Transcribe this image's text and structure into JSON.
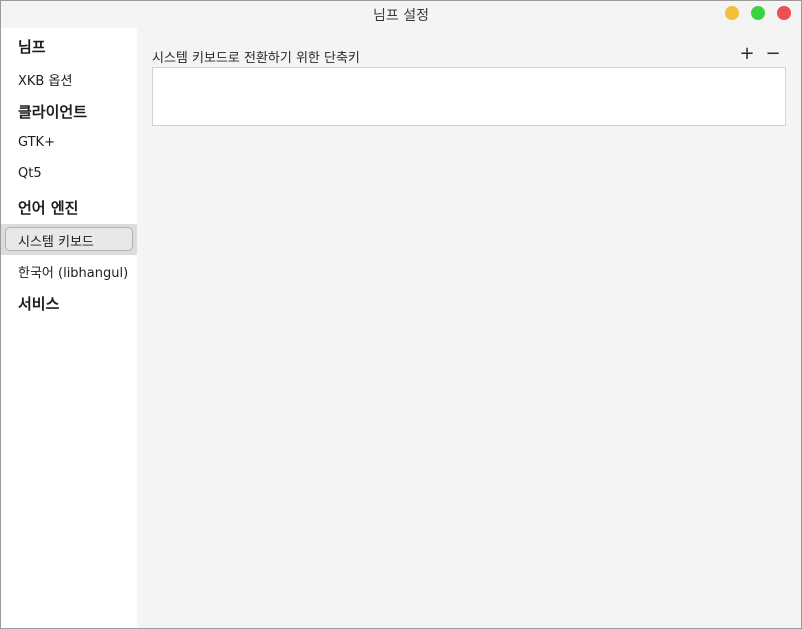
{
  "window": {
    "title": "님프 설정",
    "buttons": {
      "minimize_color": "#f3bf39",
      "maximize_color": "#3ad443",
      "close_color": "#ec4f56"
    }
  },
  "sidebar": {
    "sections": [
      {
        "label": "님프",
        "items": [
          {
            "label": "XKB 옵션"
          }
        ]
      },
      {
        "label": "클라이언트",
        "items": [
          {
            "label": "GTK+"
          },
          {
            "label": "Qt5"
          }
        ]
      },
      {
        "label": "언어 엔진",
        "items": [
          {
            "label": "시스템 키보드",
            "selected": true
          },
          {
            "label": "한국어 (libhangul)"
          }
        ]
      },
      {
        "label": "서비스",
        "items": []
      }
    ]
  },
  "main": {
    "label": "시스템 키보드로 전환하기 위한 단축키",
    "add_label": "+",
    "remove_label": "−",
    "shortcuts": []
  },
  "colors": {
    "content_bg": "#f4f4f4",
    "selected_bg": "#dcdcdc"
  }
}
